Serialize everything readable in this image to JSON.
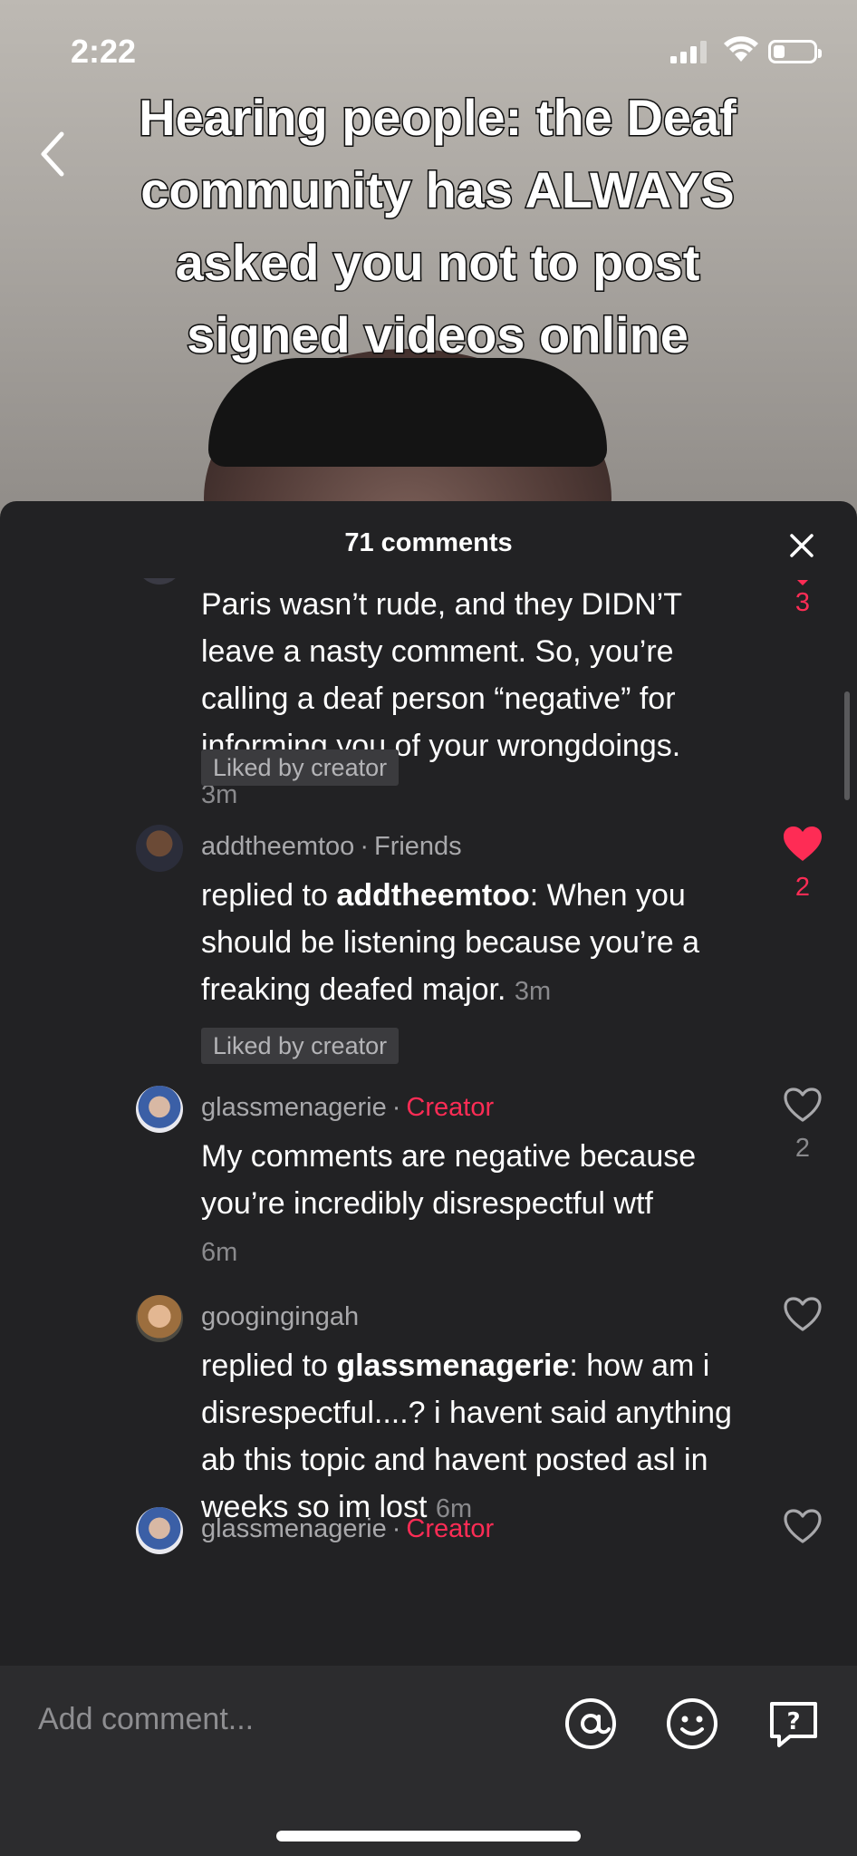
{
  "status_bar": {
    "time": "2:22"
  },
  "video": {
    "caption": "Hearing people: the Deaf community has ALWAYS asked you not to post signed videos online"
  },
  "sheet": {
    "title": "71 comments",
    "comments": [
      {
        "text": "Paris wasn’t rude, and they DIDN’T leave a nasty comment. So, you’re calling a deaf person “negative” for informing you of your wrongdoings.",
        "time": "3m",
        "liked_by_creator": "Liked by creator",
        "likes": "3",
        "liked": true
      },
      {
        "username": "addtheemtoo",
        "badge": "Friends",
        "reply_prefix": "replied to ",
        "reply_to": "addtheemtoo",
        "text": ": When you should be listening because you’re a freaking deafed major.",
        "time": "3m",
        "liked_by_creator": "Liked by creator",
        "likes": "2",
        "liked": true
      },
      {
        "username": "glassmenagerie",
        "badge": "Creator",
        "text": "My comments are negative because you’re incredibly disrespectful wtf",
        "time": "6m",
        "likes": "2",
        "liked": false
      },
      {
        "username": "googingingah",
        "reply_prefix": "replied to ",
        "reply_to": "glassmenagerie",
        "text": ": how am i disrespectful....? i havent said anything ab this topic and havent posted asl in weeks so im lost",
        "time": "6m",
        "likes": "",
        "liked": false
      },
      {
        "username": "glassmenagerie",
        "badge": "Creator"
      }
    ]
  },
  "composer": {
    "placeholder": "Add comment..."
  },
  "icons": [
    "back-icon",
    "close-icon",
    "heart-icon",
    "at-icon",
    "emoji-icon",
    "question-icon"
  ],
  "colors": {
    "accent": "#fe2c55",
    "sheet_bg": "#222224",
    "composer_bg": "#2c2c2e"
  }
}
